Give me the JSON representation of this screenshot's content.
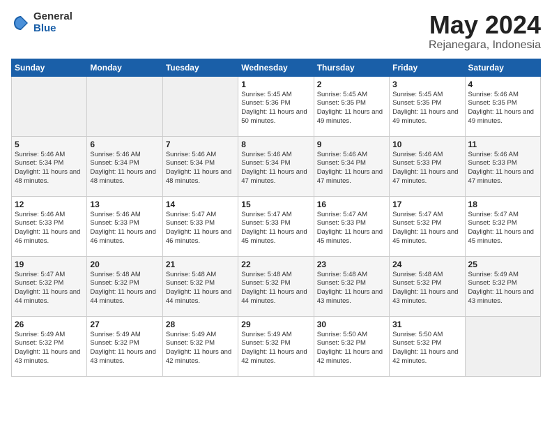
{
  "logo": {
    "general": "General",
    "blue": "Blue"
  },
  "header": {
    "month": "May 2024",
    "location": "Rejanegara, Indonesia"
  },
  "weekdays": [
    "Sunday",
    "Monday",
    "Tuesday",
    "Wednesday",
    "Thursday",
    "Friday",
    "Saturday"
  ],
  "weeks": [
    [
      null,
      null,
      null,
      {
        "num": "1",
        "sunrise": "5:45 AM",
        "sunset": "5:36 PM",
        "daylight": "11 hours and 50 minutes."
      },
      {
        "num": "2",
        "sunrise": "5:45 AM",
        "sunset": "5:35 PM",
        "daylight": "11 hours and 49 minutes."
      },
      {
        "num": "3",
        "sunrise": "5:45 AM",
        "sunset": "5:35 PM",
        "daylight": "11 hours and 49 minutes."
      },
      {
        "num": "4",
        "sunrise": "5:46 AM",
        "sunset": "5:35 PM",
        "daylight": "11 hours and 49 minutes."
      }
    ],
    [
      {
        "num": "5",
        "sunrise": "5:46 AM",
        "sunset": "5:34 PM",
        "daylight": "11 hours and 48 minutes."
      },
      {
        "num": "6",
        "sunrise": "5:46 AM",
        "sunset": "5:34 PM",
        "daylight": "11 hours and 48 minutes."
      },
      {
        "num": "7",
        "sunrise": "5:46 AM",
        "sunset": "5:34 PM",
        "daylight": "11 hours and 48 minutes."
      },
      {
        "num": "8",
        "sunrise": "5:46 AM",
        "sunset": "5:34 PM",
        "daylight": "11 hours and 47 minutes."
      },
      {
        "num": "9",
        "sunrise": "5:46 AM",
        "sunset": "5:34 PM",
        "daylight": "11 hours and 47 minutes."
      },
      {
        "num": "10",
        "sunrise": "5:46 AM",
        "sunset": "5:33 PM",
        "daylight": "11 hours and 47 minutes."
      },
      {
        "num": "11",
        "sunrise": "5:46 AM",
        "sunset": "5:33 PM",
        "daylight": "11 hours and 47 minutes."
      }
    ],
    [
      {
        "num": "12",
        "sunrise": "5:46 AM",
        "sunset": "5:33 PM",
        "daylight": "11 hours and 46 minutes."
      },
      {
        "num": "13",
        "sunrise": "5:46 AM",
        "sunset": "5:33 PM",
        "daylight": "11 hours and 46 minutes."
      },
      {
        "num": "14",
        "sunrise": "5:47 AM",
        "sunset": "5:33 PM",
        "daylight": "11 hours and 46 minutes."
      },
      {
        "num": "15",
        "sunrise": "5:47 AM",
        "sunset": "5:33 PM",
        "daylight": "11 hours and 45 minutes."
      },
      {
        "num": "16",
        "sunrise": "5:47 AM",
        "sunset": "5:33 PM",
        "daylight": "11 hours and 45 minutes."
      },
      {
        "num": "17",
        "sunrise": "5:47 AM",
        "sunset": "5:32 PM",
        "daylight": "11 hours and 45 minutes."
      },
      {
        "num": "18",
        "sunrise": "5:47 AM",
        "sunset": "5:32 PM",
        "daylight": "11 hours and 45 minutes."
      }
    ],
    [
      {
        "num": "19",
        "sunrise": "5:47 AM",
        "sunset": "5:32 PM",
        "daylight": "11 hours and 44 minutes."
      },
      {
        "num": "20",
        "sunrise": "5:48 AM",
        "sunset": "5:32 PM",
        "daylight": "11 hours and 44 minutes."
      },
      {
        "num": "21",
        "sunrise": "5:48 AM",
        "sunset": "5:32 PM",
        "daylight": "11 hours and 44 minutes."
      },
      {
        "num": "22",
        "sunrise": "5:48 AM",
        "sunset": "5:32 PM",
        "daylight": "11 hours and 44 minutes."
      },
      {
        "num": "23",
        "sunrise": "5:48 AM",
        "sunset": "5:32 PM",
        "daylight": "11 hours and 43 minutes."
      },
      {
        "num": "24",
        "sunrise": "5:48 AM",
        "sunset": "5:32 PM",
        "daylight": "11 hours and 43 minutes."
      },
      {
        "num": "25",
        "sunrise": "5:49 AM",
        "sunset": "5:32 PM",
        "daylight": "11 hours and 43 minutes."
      }
    ],
    [
      {
        "num": "26",
        "sunrise": "5:49 AM",
        "sunset": "5:32 PM",
        "daylight": "11 hours and 43 minutes."
      },
      {
        "num": "27",
        "sunrise": "5:49 AM",
        "sunset": "5:32 PM",
        "daylight": "11 hours and 43 minutes."
      },
      {
        "num": "28",
        "sunrise": "5:49 AM",
        "sunset": "5:32 PM",
        "daylight": "11 hours and 42 minutes."
      },
      {
        "num": "29",
        "sunrise": "5:49 AM",
        "sunset": "5:32 PM",
        "daylight": "11 hours and 42 minutes."
      },
      {
        "num": "30",
        "sunrise": "5:50 AM",
        "sunset": "5:32 PM",
        "daylight": "11 hours and 42 minutes."
      },
      {
        "num": "31",
        "sunrise": "5:50 AM",
        "sunset": "5:32 PM",
        "daylight": "11 hours and 42 minutes."
      },
      null
    ]
  ],
  "labels": {
    "sunrise": "Sunrise:",
    "sunset": "Sunset:",
    "daylight": "Daylight:"
  }
}
